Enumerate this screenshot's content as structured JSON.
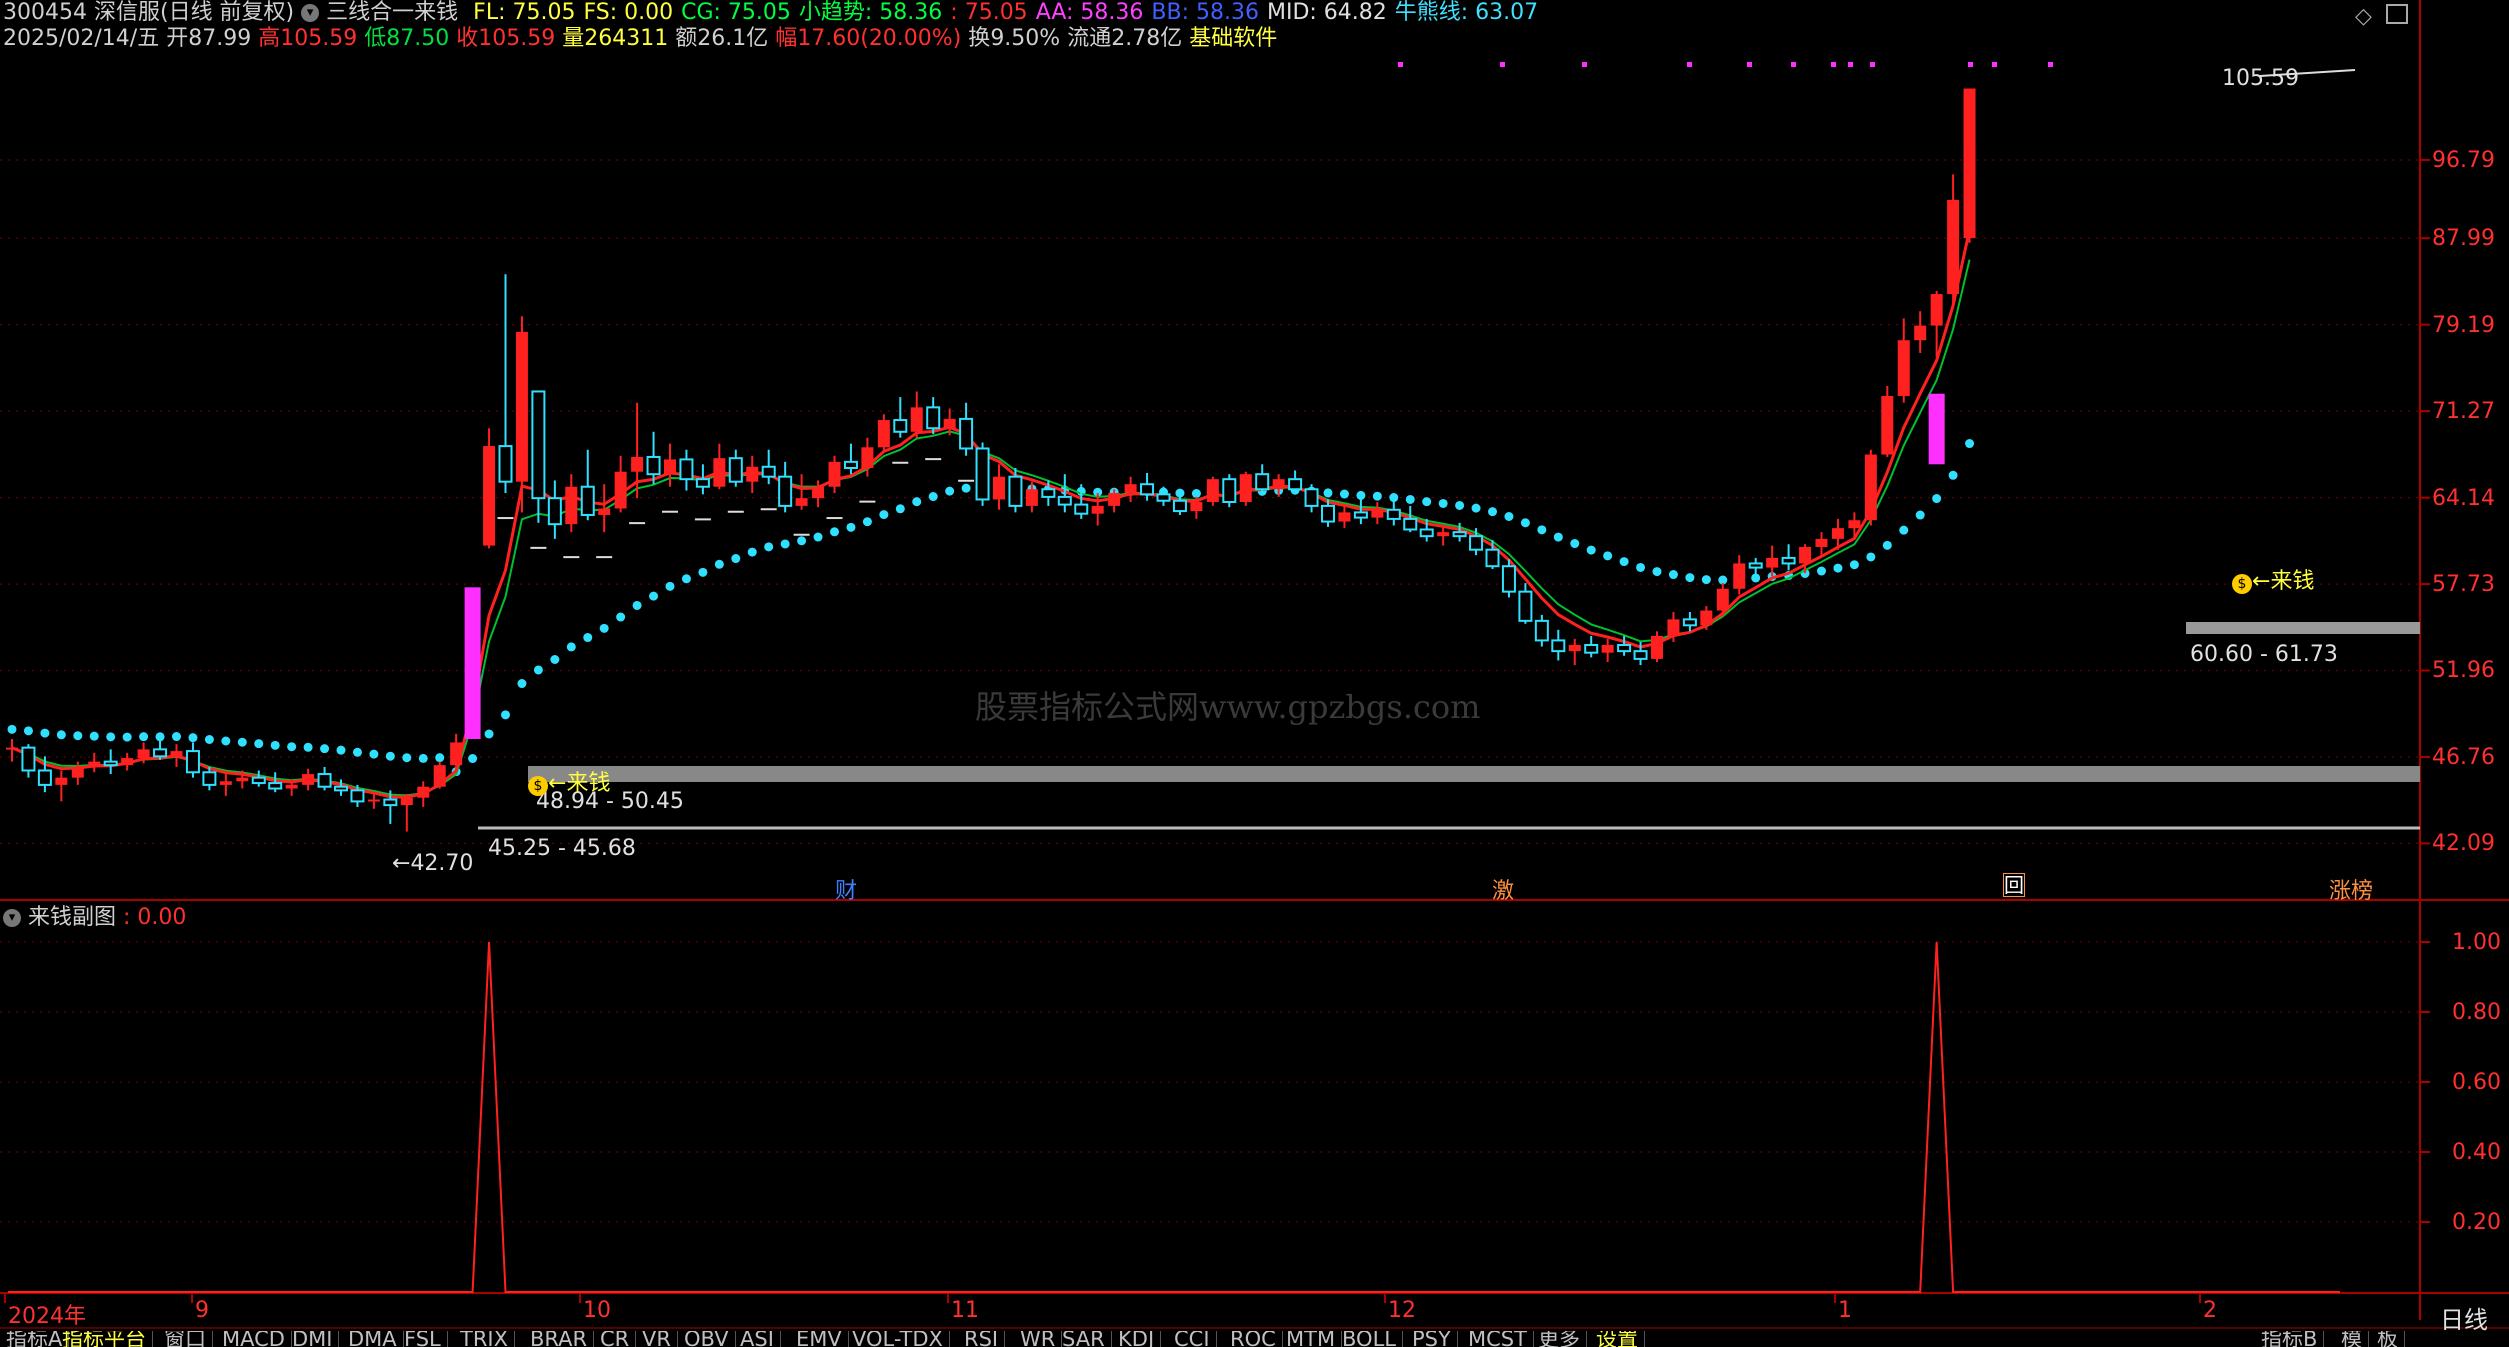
{
  "header": {
    "stock_code": "300454",
    "stock_name": "深信服(日线 前复权)",
    "indicator_name": "三线合一来钱",
    "indicators": [
      {
        "label": "FL:",
        "value": "75.05",
        "color": "#ffff40"
      },
      {
        "label": "FS:",
        "value": "0.00",
        "color": "#ffff40"
      },
      {
        "label": "CG:",
        "value": "75.05",
        "color": "#00ff40"
      },
      {
        "label": "小趋势:",
        "value": "58.36",
        "color": "#00ff40"
      },
      {
        "label": ":",
        "value": "75.05",
        "color": "#ff3030"
      },
      {
        "label": "AA:",
        "value": "58.36",
        "color": "#ff40ff"
      },
      {
        "label": "BB:",
        "value": "58.36",
        "color": "#4060ff"
      },
      {
        "label": "MID:",
        "value": "64.82",
        "color": "#e0e0e0"
      },
      {
        "label": "牛熊线:",
        "value": "63.07",
        "color": "#40e0ff"
      }
    ],
    "date": "2025/02/14/五",
    "open_label": "开",
    "open": "87.99",
    "high_label": "高",
    "high": "105.59",
    "low_label": "低",
    "low": "87.50",
    "close_label": "收",
    "close": "105.59",
    "volume_label": "量",
    "volume": "264311",
    "amount_label": "额",
    "amount": "26.1亿",
    "change_label": "幅",
    "change": "17.60(20.00%)",
    "turnover_label": "换",
    "turnover": "9.50%",
    "float_label": "流通",
    "float": "2.78亿",
    "software": "基础软件"
  },
  "top_icons": [
    "diamond-icon",
    "window-icon"
  ],
  "price_axis": [
    "96.79",
    "87.99",
    "79.19",
    "71.27",
    "64.14",
    "57.73",
    "51.96",
    "46.76",
    "42.09"
  ],
  "annotations": {
    "peak_price": "105.59",
    "low_price": "42.70",
    "band1": "45.25 - 45.68",
    "band2": "48.94 - 50.45",
    "band3": "60.60 - 61.73",
    "signal_label": "来钱",
    "watermark": "股票指标公式网www.gpzbgs.com"
  },
  "event_markers": [
    {
      "label": "财",
      "color": "#4080ff"
    },
    {
      "label": "激",
      "color": "#ff9040"
    },
    {
      "label": "回",
      "color": "#ffffff"
    },
    {
      "label": "涨榜",
      "color": "#ff9040"
    }
  ],
  "sub_chart": {
    "title": "来钱副图",
    "value": ": 0.00",
    "axis": [
      "1.00",
      "0.80",
      "0.60",
      "0.40",
      "0.20"
    ]
  },
  "time_axis": [
    "2024年",
    "9",
    "10",
    "11",
    "12",
    "1",
    "2"
  ],
  "period": "日线",
  "bottom_tabs": [
    "指标A",
    "指标平台",
    "窗口",
    "MACD",
    "DMI",
    "DMA",
    "FSL",
    "TRIX",
    "BRAR",
    "CR",
    "VR",
    "OBV",
    "ASI",
    "EMV",
    "VOL-TDX",
    "RSI",
    "WR",
    "SAR",
    "KDJ",
    "CCI",
    "ROC",
    "MTM",
    "BOLL",
    "PSY",
    "MCST",
    "更多",
    "设置"
  ],
  "bottom_right_tabs": [
    "指标B",
    "模",
    "板"
  ],
  "chart_data": {
    "type": "candlestick",
    "title": "",
    "y_scale": "log",
    "ylim": [
      40.5,
      108
    ],
    "ohlc": [
      [
        47.2,
        47.8,
        46.5,
        47.3
      ],
      [
        47.3,
        47.5,
        45.6,
        46.0
      ],
      [
        46.0,
        46.8,
        44.8,
        45.2
      ],
      [
        45.2,
        46.0,
        44.3,
        45.6
      ],
      [
        45.6,
        46.5,
        45.2,
        46.2
      ],
      [
        46.2,
        47.0,
        45.9,
        46.5
      ],
      [
        46.5,
        47.2,
        45.8,
        46.3
      ],
      [
        46.3,
        47.0,
        46.0,
        46.7
      ],
      [
        46.7,
        47.6,
        46.4,
        47.2
      ],
      [
        47.2,
        48.0,
        46.6,
        46.8
      ],
      [
        46.8,
        47.5,
        46.2,
        47.1
      ],
      [
        47.1,
        47.6,
        45.6,
        45.9
      ],
      [
        45.9,
        46.2,
        44.9,
        45.2
      ],
      [
        45.2,
        45.8,
        44.6,
        45.4
      ],
      [
        45.4,
        46.0,
        45.0,
        45.6
      ],
      [
        45.6,
        46.0,
        45.1,
        45.3
      ],
      [
        45.3,
        45.9,
        44.8,
        45.0
      ],
      [
        45.0,
        45.5,
        44.6,
        45.2
      ],
      [
        45.2,
        46.1,
        44.9,
        45.8
      ],
      [
        45.8,
        46.2,
        44.9,
        45.1
      ],
      [
        45.1,
        45.5,
        44.6,
        44.9
      ],
      [
        44.9,
        45.2,
        44.0,
        44.3
      ],
      [
        44.3,
        44.8,
        43.9,
        44.4
      ],
      [
        44.4,
        44.9,
        43.1,
        44.1
      ],
      [
        44.1,
        44.7,
        42.7,
        44.5
      ],
      [
        44.5,
        45.4,
        44.0,
        45.1
      ],
      [
        45.1,
        46.5,
        45.0,
        46.3
      ],
      [
        46.3,
        48.1,
        46.1,
        47.6
      ],
      [
        48.1,
        57.2,
        48.0,
        57.2
      ],
      [
        60.5,
        69.8,
        60.3,
        68.3
      ],
      [
        68.3,
        84.2,
        64.5,
        65.4
      ],
      [
        65.4,
        80.0,
        63.0,
        78.5
      ],
      [
        73.0,
        73.0,
        62.2,
        64.1
      ],
      [
        64.1,
        65.5,
        61.0,
        62.1
      ],
      [
        62.1,
        66.0,
        61.5,
        65.0
      ],
      [
        65.0,
        68.0,
        62.4,
        62.8
      ],
      [
        62.8,
        65.2,
        61.5,
        63.3
      ],
      [
        63.3,
        67.5,
        63.0,
        66.2
      ],
      [
        66.2,
        72.0,
        64.1,
        67.4
      ],
      [
        67.4,
        69.5,
        65.2,
        66.0
      ],
      [
        66.0,
        68.5,
        65.0,
        67.2
      ],
      [
        67.2,
        68.0,
        64.7,
        65.6
      ],
      [
        65.6,
        66.8,
        64.4,
        65.0
      ],
      [
        65.0,
        68.5,
        64.8,
        67.3
      ],
      [
        67.3,
        68.0,
        65.0,
        65.4
      ],
      [
        65.4,
        67.5,
        64.5,
        66.6
      ],
      [
        66.6,
        68.0,
        65.2,
        65.8
      ],
      [
        65.8,
        67.0,
        63.0,
        63.5
      ],
      [
        63.5,
        66.0,
        63.2,
        64.1
      ],
      [
        64.1,
        65.5,
        63.4,
        65.0
      ],
      [
        65.0,
        67.5,
        64.5,
        67.0
      ],
      [
        67.0,
        68.5,
        66.0,
        66.5
      ],
      [
        66.5,
        69.0,
        65.8,
        68.2
      ],
      [
        68.2,
        71.0,
        67.8,
        70.5
      ],
      [
        70.5,
        72.5,
        69.0,
        69.5
      ],
      [
        69.5,
        73.0,
        69.0,
        71.6
      ],
      [
        71.6,
        72.5,
        69.3,
        69.8
      ],
      [
        69.8,
        71.5,
        69.2,
        70.6
      ],
      [
        70.6,
        72.0,
        67.5,
        68.1
      ],
      [
        68.1,
        68.6,
        63.5,
        64.0
      ],
      [
        64.0,
        66.8,
        63.2,
        65.8
      ],
      [
        65.8,
        66.5,
        63.0,
        63.5
      ],
      [
        63.5,
        65.4,
        63.0,
        64.8
      ],
      [
        64.8,
        65.5,
        63.5,
        64.2
      ],
      [
        64.2,
        66.0,
        63.0,
        63.6
      ],
      [
        63.6,
        65.2,
        62.5,
        62.9
      ],
      [
        62.9,
        64.5,
        62.0,
        63.5
      ],
      [
        63.5,
        64.8,
        63.0,
        64.5
      ],
      [
        64.5,
        65.8,
        63.8,
        65.2
      ],
      [
        65.2,
        66.1,
        63.9,
        64.4
      ],
      [
        64.4,
        65.0,
        63.5,
        63.9
      ],
      [
        63.9,
        64.8,
        62.8,
        63.1
      ],
      [
        63.1,
        64.2,
        62.5,
        63.8
      ],
      [
        63.8,
        65.8,
        63.5,
        65.6
      ],
      [
        65.6,
        66.0,
        63.4,
        63.8
      ],
      [
        63.8,
        66.2,
        63.5,
        66.0
      ],
      [
        66.0,
        66.8,
        64.5,
        64.8
      ],
      [
        64.8,
        66.0,
        64.2,
        65.6
      ],
      [
        65.6,
        66.3,
        64.6,
        64.8
      ],
      [
        64.8,
        65.2,
        63.0,
        63.5
      ],
      [
        63.5,
        64.0,
        61.9,
        62.3
      ],
      [
        62.3,
        63.5,
        61.8,
        63.0
      ],
      [
        63.0,
        64.2,
        62.1,
        62.6
      ],
      [
        62.6,
        63.8,
        62.1,
        63.2
      ],
      [
        63.2,
        64.0,
        62.0,
        62.5
      ],
      [
        62.5,
        63.5,
        61.5,
        61.7
      ],
      [
        61.7,
        62.5,
        60.8,
        61.2
      ],
      [
        61.2,
        62.0,
        60.5,
        61.5
      ],
      [
        61.5,
        62.2,
        60.8,
        61.2
      ],
      [
        61.2,
        61.8,
        59.8,
        60.2
      ],
      [
        60.2,
        60.9,
        58.8,
        59.0
      ],
      [
        59.0,
        59.5,
        56.8,
        57.2
      ],
      [
        57.2,
        57.8,
        55.0,
        55.2
      ],
      [
        55.2,
        55.6,
        53.5,
        53.9
      ],
      [
        53.9,
        54.6,
        52.6,
        53.2
      ],
      [
        53.2,
        54.0,
        52.3,
        53.6
      ],
      [
        53.6,
        54.2,
        52.8,
        53.1
      ],
      [
        53.1,
        54.0,
        52.5,
        53.6
      ],
      [
        53.6,
        54.2,
        52.9,
        53.2
      ],
      [
        53.2,
        53.8,
        52.3,
        52.7
      ],
      [
        52.7,
        54.5,
        52.5,
        54.2
      ],
      [
        54.2,
        55.8,
        53.8,
        55.3
      ],
      [
        55.3,
        55.8,
        54.5,
        54.9
      ],
      [
        54.9,
        56.2,
        54.6,
        55.9
      ],
      [
        55.9,
        57.8,
        55.5,
        57.4
      ],
      [
        57.4,
        59.8,
        57.0,
        59.2
      ],
      [
        59.2,
        59.6,
        58.4,
        58.9
      ],
      [
        58.9,
        60.5,
        58.3,
        59.6
      ],
      [
        59.6,
        60.6,
        58.7,
        59.2
      ],
      [
        59.2,
        60.6,
        58.5,
        60.4
      ],
      [
        60.4,
        61.5,
        59.8,
        61.0
      ],
      [
        61.0,
        62.5,
        60.2,
        61.8
      ],
      [
        61.8,
        63.0,
        61.0,
        62.4
      ],
      [
        62.4,
        68.0,
        62.0,
        67.6
      ],
      [
        67.6,
        73.5,
        67.4,
        72.6
      ],
      [
        72.6,
        79.8,
        72.0,
        77.7
      ],
      [
        77.7,
        80.5,
        76.5,
        79.1
      ],
      [
        79.1,
        82.5,
        76.1,
        82.2
      ],
      [
        82.2,
        95.1,
        81.0,
        92.2
      ],
      [
        87.99,
        105.59,
        87.5,
        105.59
      ]
    ],
    "series": [
      {
        "name": "FL",
        "values": []
      },
      {
        "name": "CG",
        "values": []
      },
      {
        "name": "牛熊线",
        "values": []
      }
    ],
    "sub_values_peaks": [
      {
        "index": 29,
        "value": 1.0
      },
      {
        "index": 117,
        "value": 1.0
      }
    ]
  }
}
